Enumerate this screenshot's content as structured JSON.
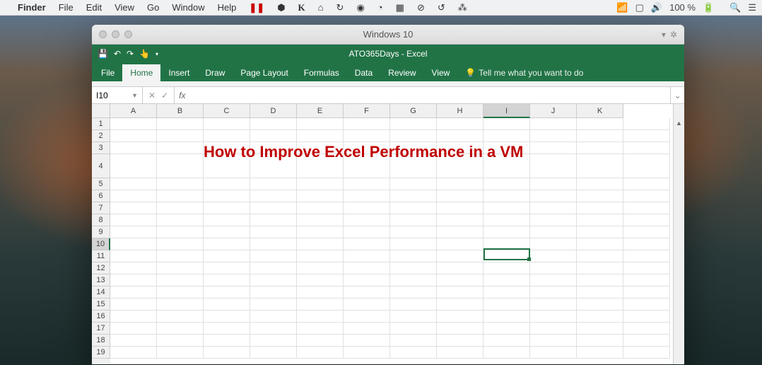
{
  "mac_menu": {
    "app": "Finder",
    "items": [
      "File",
      "Edit",
      "View",
      "Go",
      "Window",
      "Help"
    ],
    "battery": "100 %"
  },
  "vm": {
    "title": "Windows 10"
  },
  "excel": {
    "title": "ATO365Days - Excel",
    "tabs": [
      "File",
      "Home",
      "Insert",
      "Draw",
      "Page Layout",
      "Formulas",
      "Data",
      "Review",
      "View"
    ],
    "active_tab": "Home",
    "tell_me": "Tell me what you want to do",
    "name_box": "I10",
    "formula": "",
    "columns": [
      "A",
      "B",
      "C",
      "D",
      "E",
      "F",
      "G",
      "H",
      "I",
      "J",
      "K"
    ],
    "rows": [
      "1",
      "2",
      "3",
      "4",
      "5",
      "6",
      "7",
      "8",
      "9",
      "10",
      "11",
      "12",
      "13",
      "14",
      "15",
      "16",
      "17",
      "18",
      "19"
    ],
    "active_col": "I",
    "active_row": "10",
    "merged_cell": {
      "text": "How to Improve Excel Performance in a VM",
      "row": "4",
      "start_col": "C"
    }
  }
}
